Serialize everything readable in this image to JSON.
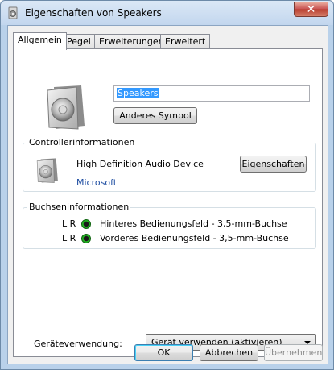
{
  "window": {
    "title": "Eigenschaften von Speakers",
    "close_glyph": "✕"
  },
  "tabs": [
    {
      "label": "Allgemein",
      "active": true
    },
    {
      "label": "Pegel",
      "active": false
    },
    {
      "label": "Erweiterungen",
      "active": false
    },
    {
      "label": "Erweitert",
      "active": false
    }
  ],
  "general": {
    "device_name_value": "Speakers",
    "change_icon_label": "Anderes Symbol"
  },
  "controller": {
    "group_label": "Controllerinformationen",
    "device": "High Definition Audio Device",
    "vendor": "Microsoft",
    "properties_label": "Eigenschaften"
  },
  "jacks": {
    "group_label": "Buchseninformationen",
    "items": [
      {
        "channels": "L R",
        "label": "Hinteres Bedienungsfeld - 3,5-mm-Buchse",
        "color": "#23b423"
      },
      {
        "channels": "L R",
        "label": "Vorderes Bedienungsfeld - 3,5-mm-Buchse",
        "color": "#23b423"
      }
    ]
  },
  "usage": {
    "label": "Geräteverwendung:",
    "selected": "Gerät verwenden (aktivieren)"
  },
  "footer": {
    "ok_label": "OK",
    "cancel_label": "Abbrechen",
    "apply_label": "Übernehmen"
  }
}
